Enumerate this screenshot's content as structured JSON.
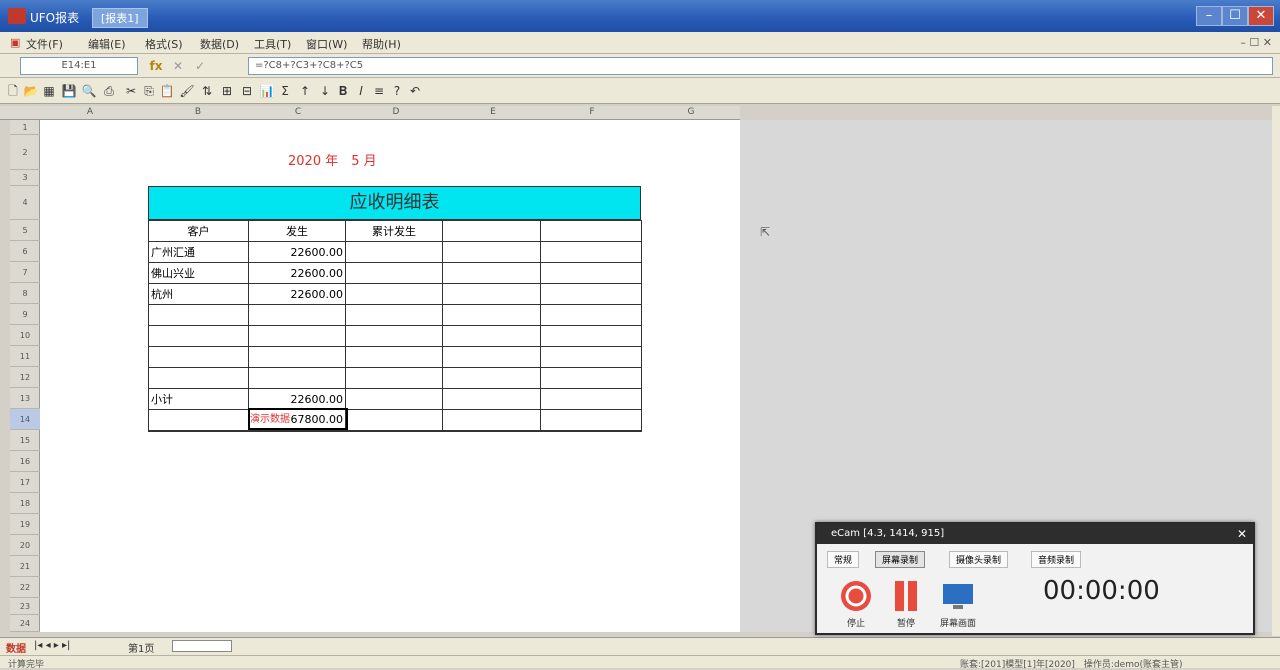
{
  "titlebar": {
    "title": "UFO报表",
    "tab_title": "[报表1]",
    "minimize": "–",
    "maximize": "☐",
    "close": "✕"
  },
  "menubar": {
    "items": [
      "文件(F)",
      "编辑(E)",
      "格式(S)",
      "数据(D)",
      "工具(T)",
      "窗口(W)",
      "帮助(H)"
    ],
    "corner": "– ☐ ✕"
  },
  "formulabar": {
    "name_box": "E14:E1",
    "formula": "=?C8+?C3+?C8+?C5",
    "fx": "fx",
    "cancel": "✕",
    "confirm": "✓"
  },
  "colheaders": [
    "A",
    "B",
    "C",
    "D",
    "E",
    "F",
    "G"
  ],
  "rowheaders": [
    "1",
    "2",
    "3",
    "4",
    "5",
    "6",
    "7",
    "8",
    "9",
    "10",
    "11",
    "12",
    "13",
    "14",
    "15",
    "16",
    "17",
    "18",
    "19",
    "20",
    "21",
    "22",
    "23",
    "24"
  ],
  "sheet": {
    "date_line": "2020 年　5 月",
    "table_title": "应收明细表",
    "headers": [
      "客户",
      "发生",
      "累计发生",
      "",
      ""
    ],
    "rows": [
      [
        "广州汇通",
        "22600.00",
        "",
        "",
        ""
      ],
      [
        "佛山兴业",
        "22600.00",
        "",
        "",
        ""
      ],
      [
        "杭州",
        "22600.00",
        "",
        "",
        ""
      ],
      [
        "",
        "",
        "",
        "",
        ""
      ],
      [
        "",
        "",
        "",
        "",
        ""
      ],
      [
        "",
        "",
        "",
        "",
        ""
      ],
      [
        "",
        "",
        "",
        "",
        ""
      ],
      [
        "小计",
        "22600.00",
        "",
        "",
        ""
      ],
      [
        "",
        "67800.00",
        "",
        "",
        ""
      ]
    ],
    "stamp": "演示数据"
  },
  "sheettabs": {
    "mode": "数据",
    "nav": "|◂ ◂ ▸ ▸|",
    "tab": "第1页"
  },
  "statusbar": {
    "left": "计算完毕",
    "right": "账套:[201]模型[1]年[2020]　操作员:demo(账套主管)"
  },
  "recorder": {
    "title": "eCam [4.3, 1414, 915]",
    "tabs": [
      "常规",
      "屏幕录制",
      "摄像头录制",
      "音频录制"
    ],
    "active_tab": "屏幕录制",
    "time": "00:00:00",
    "buttons": [
      "停止",
      "暂停",
      "屏幕画面"
    ],
    "colors": {
      "stop": "#e74c3c",
      "pause": "#e74c3c",
      "screen": "#2b6fc2"
    }
  }
}
